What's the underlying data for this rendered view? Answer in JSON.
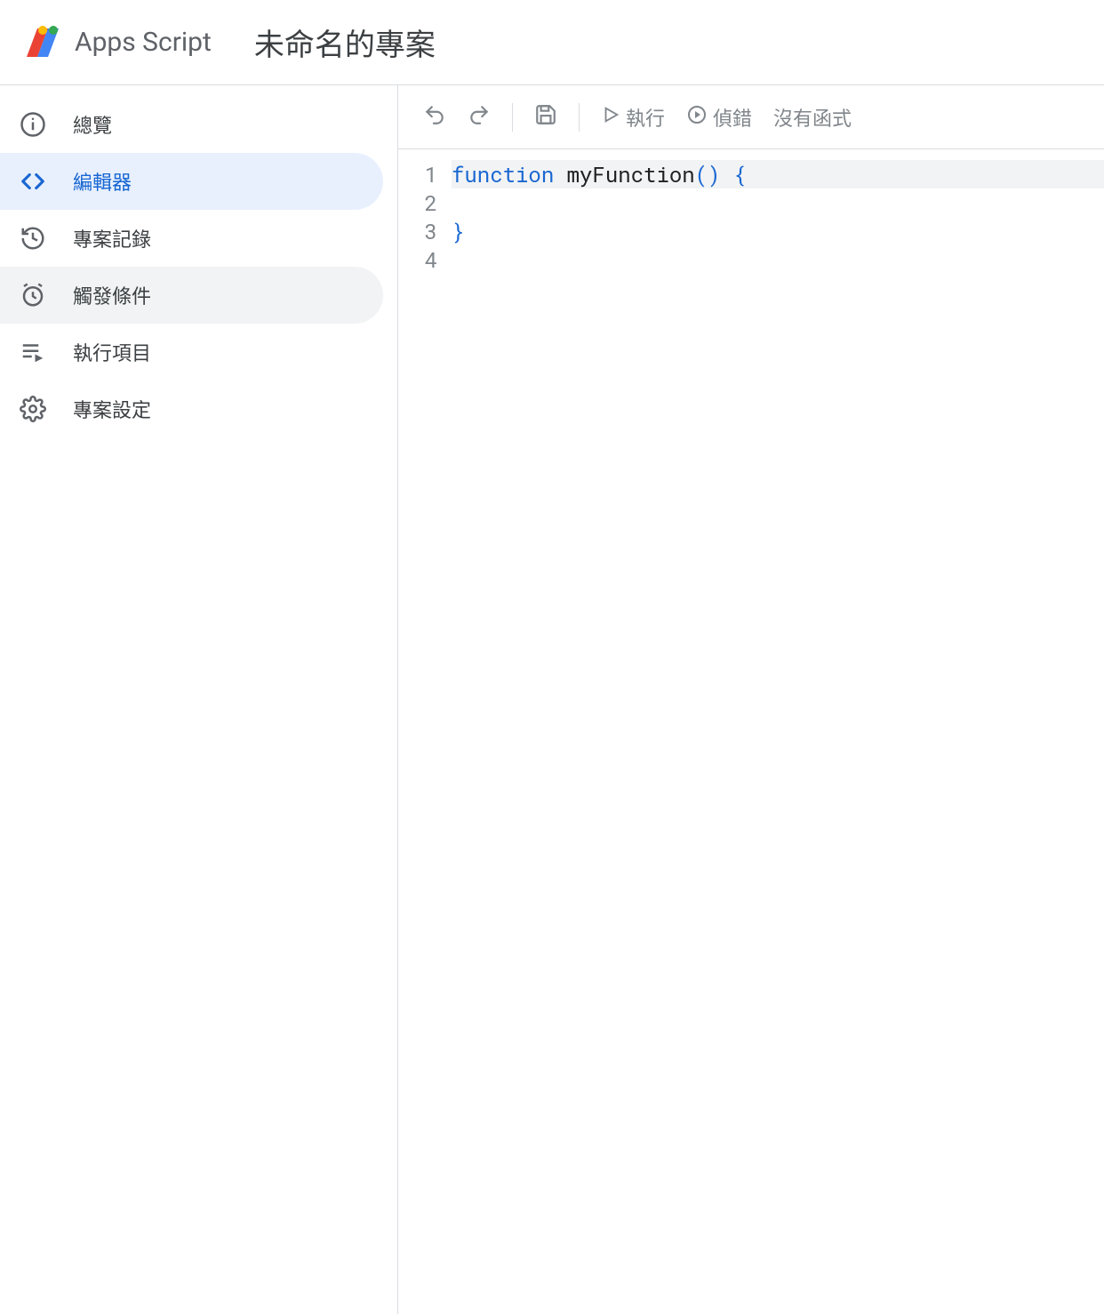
{
  "header": {
    "product": "Apps Script",
    "project_title": "未命名的專案"
  },
  "sidebar": {
    "items": [
      {
        "label": "總覽",
        "icon": "info"
      },
      {
        "label": "編輯器",
        "icon": "code",
        "active": true
      },
      {
        "label": "專案記錄",
        "icon": "history"
      },
      {
        "label": "觸發條件",
        "icon": "alarm",
        "hover": true
      },
      {
        "label": "執行項目",
        "icon": "playlist"
      },
      {
        "label": "專案設定",
        "icon": "gear"
      }
    ]
  },
  "toolbar": {
    "run_label": "執行",
    "debug_label": "偵錯",
    "no_function_label": "沒有函式"
  },
  "code": {
    "lines": [
      "1",
      "2",
      "3",
      "4"
    ],
    "line1_keyword": "function",
    "line1_fn": " myFunction",
    "line1_paren": "()",
    "line1_open": " {",
    "line3_close": "}"
  }
}
